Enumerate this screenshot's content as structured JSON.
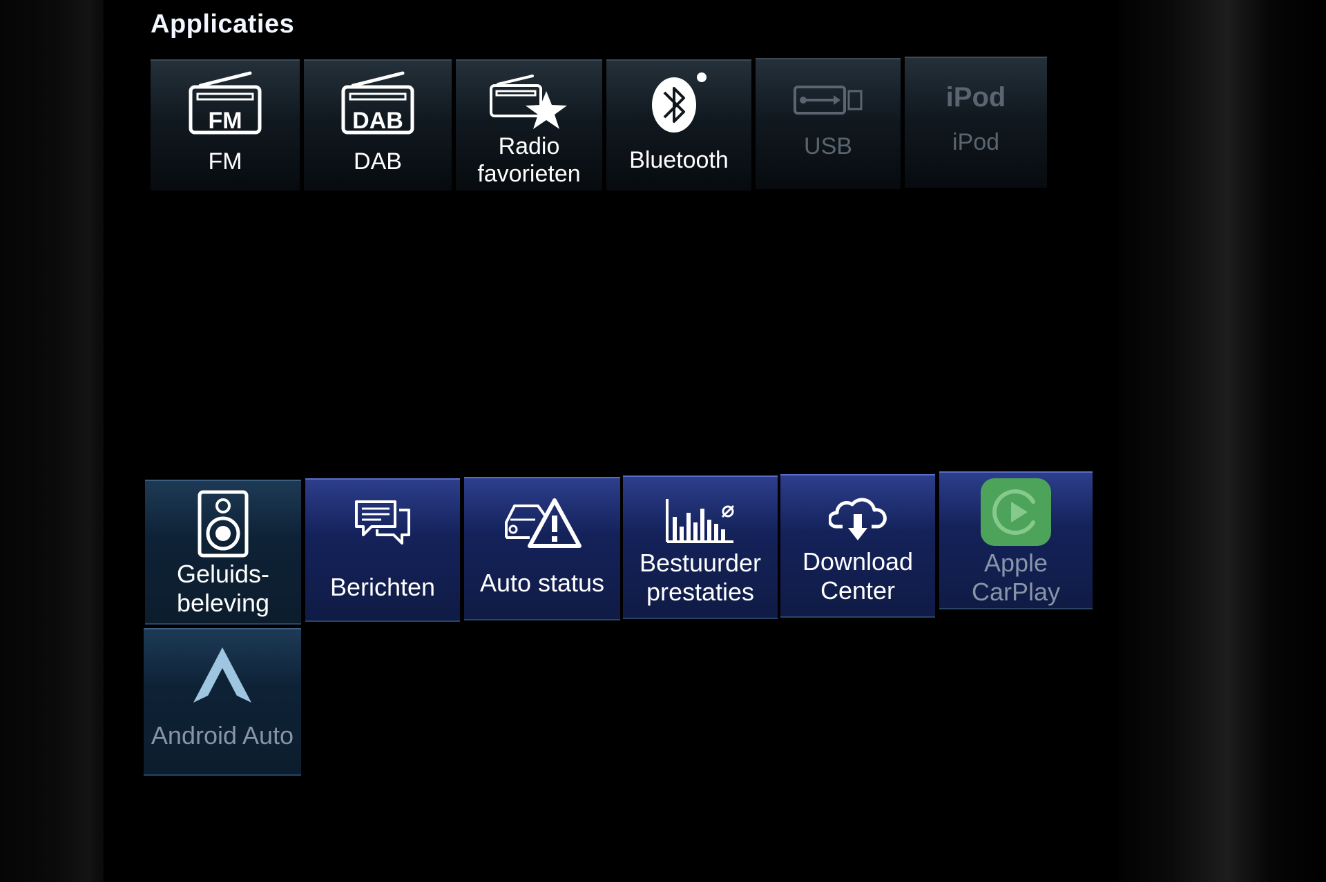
{
  "header": {
    "title": "Applicaties"
  },
  "row1": [
    {
      "label": "FM",
      "icon": "fm-radio-icon",
      "icon_text": "FM"
    },
    {
      "label": "DAB",
      "icon": "dab-radio-icon",
      "icon_text": "DAB"
    },
    {
      "label_line1": "Radio",
      "label_line2": "favorieten",
      "icon": "radio-favorite-star-icon"
    },
    {
      "label": "Bluetooth",
      "icon": "bluetooth-icon"
    },
    {
      "label": "USB",
      "icon": "usb-icon",
      "state": "disabled"
    },
    {
      "label": "iPod",
      "icon": "ipod-icon",
      "icon_text": "iPod",
      "state": "disabled"
    }
  ],
  "row2": [
    {
      "label_line1": "Geluids-",
      "label_line2": "beleving",
      "icon": "speaker-icon"
    },
    {
      "label": "Berichten",
      "icon": "messages-icon"
    },
    {
      "label": "Auto status",
      "icon": "car-warning-icon"
    },
    {
      "label_line1": "Bestuurder",
      "label_line2": "prestaties",
      "icon": "bar-chart-icon"
    },
    {
      "label_line1": "Download",
      "label_line2": "Center",
      "icon": "cloud-download-icon"
    },
    {
      "label_line1": "Apple",
      "label_line2": "CarPlay",
      "icon": "carplay-icon",
      "state": "disabled"
    },
    {
      "label": "Android Auto",
      "icon": "android-auto-icon",
      "state": "disabled"
    }
  ],
  "colors": {
    "background": "#000000",
    "tile_dark": "#111920",
    "tile_blue": "#0e2236",
    "tile_violet": "#14225a",
    "carplay_green": "#4da35a",
    "android_blue": "#9ec6e0"
  }
}
